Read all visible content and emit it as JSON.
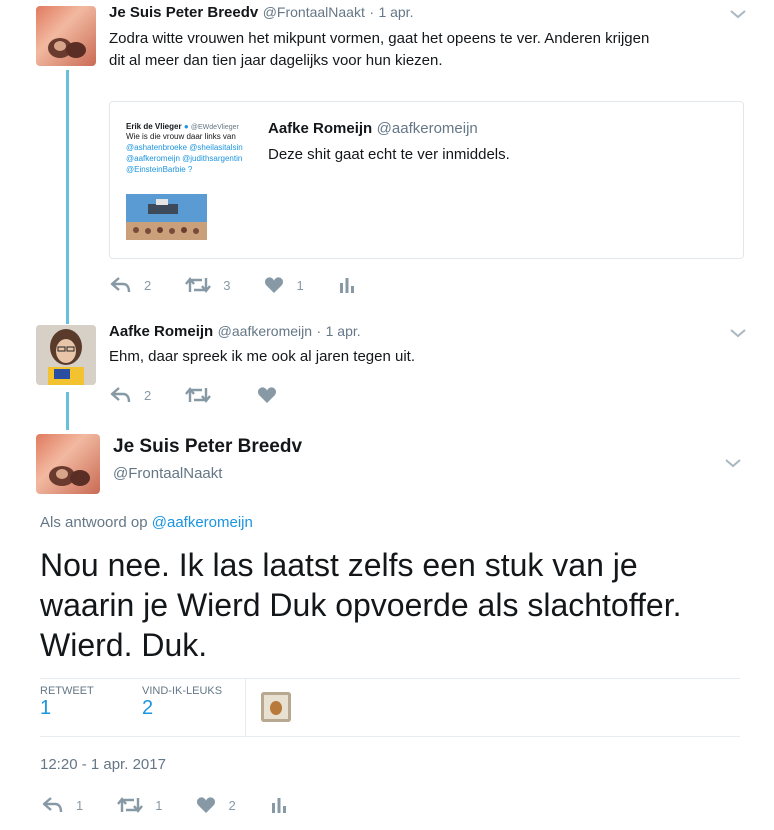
{
  "tweet1": {
    "name": "Je Suis Peter Breedv",
    "handle": "@FrontaalNaakt",
    "date": "1 apr.",
    "text_line1": "Zodra witte vrouwen het mikpunt vormen, gaat het opeens te ver. Anderen krijgen",
    "text_line2": "dit al meer dan tien jaar dagelijks voor hun kiezen.",
    "quote": {
      "name": "Aafke Romeijn",
      "handle": "@aafkeromeijn",
      "text": "Deze shit gaat echt te ver inmiddels.",
      "embedded": {
        "author": "Erik de Vlieger",
        "author_handle": "@EWdeVlieger",
        "line1": "Wie is die vrouw daar links van",
        "line2": "@ashatenbroeke @sheilasitalsin",
        "line3": "@aafkeromeijn @judithsargentin",
        "line4": "@EinsteinBarbie ?"
      }
    },
    "replies": "2",
    "retweets": "3",
    "likes": "1"
  },
  "tweet2": {
    "name": "Aafke Romeijn",
    "handle": "@aafkeromeijn",
    "date": "1 apr.",
    "text": "Ehm, daar spreek ik me ook al jaren tegen uit.",
    "replies": "2"
  },
  "main": {
    "name": "Je Suis Peter Breedv",
    "handle": "@FrontaalNaakt",
    "reply_prefix": "Als antwoord op",
    "reply_to": "@aafkeromeijn",
    "text_line1": "Nou nee. Ik las laatst zelfs een stuk van je",
    "text_line2": "waarin je Wierd Duk opvoerde als slachtoffer.",
    "text_line3": "Wierd. Duk.",
    "retweet_label": "RETWEET",
    "retweet_count": "1",
    "likes_label": "VIND-IK-LEUKS",
    "likes_count": "2",
    "timestamp": "12:20 - 1 apr. 2017",
    "replies": "1",
    "retweets": "1",
    "likes": "2"
  },
  "colors": {
    "thread_line": "#66c0de",
    "link": "#1b95e0",
    "icon_gray": "#8899a6"
  }
}
